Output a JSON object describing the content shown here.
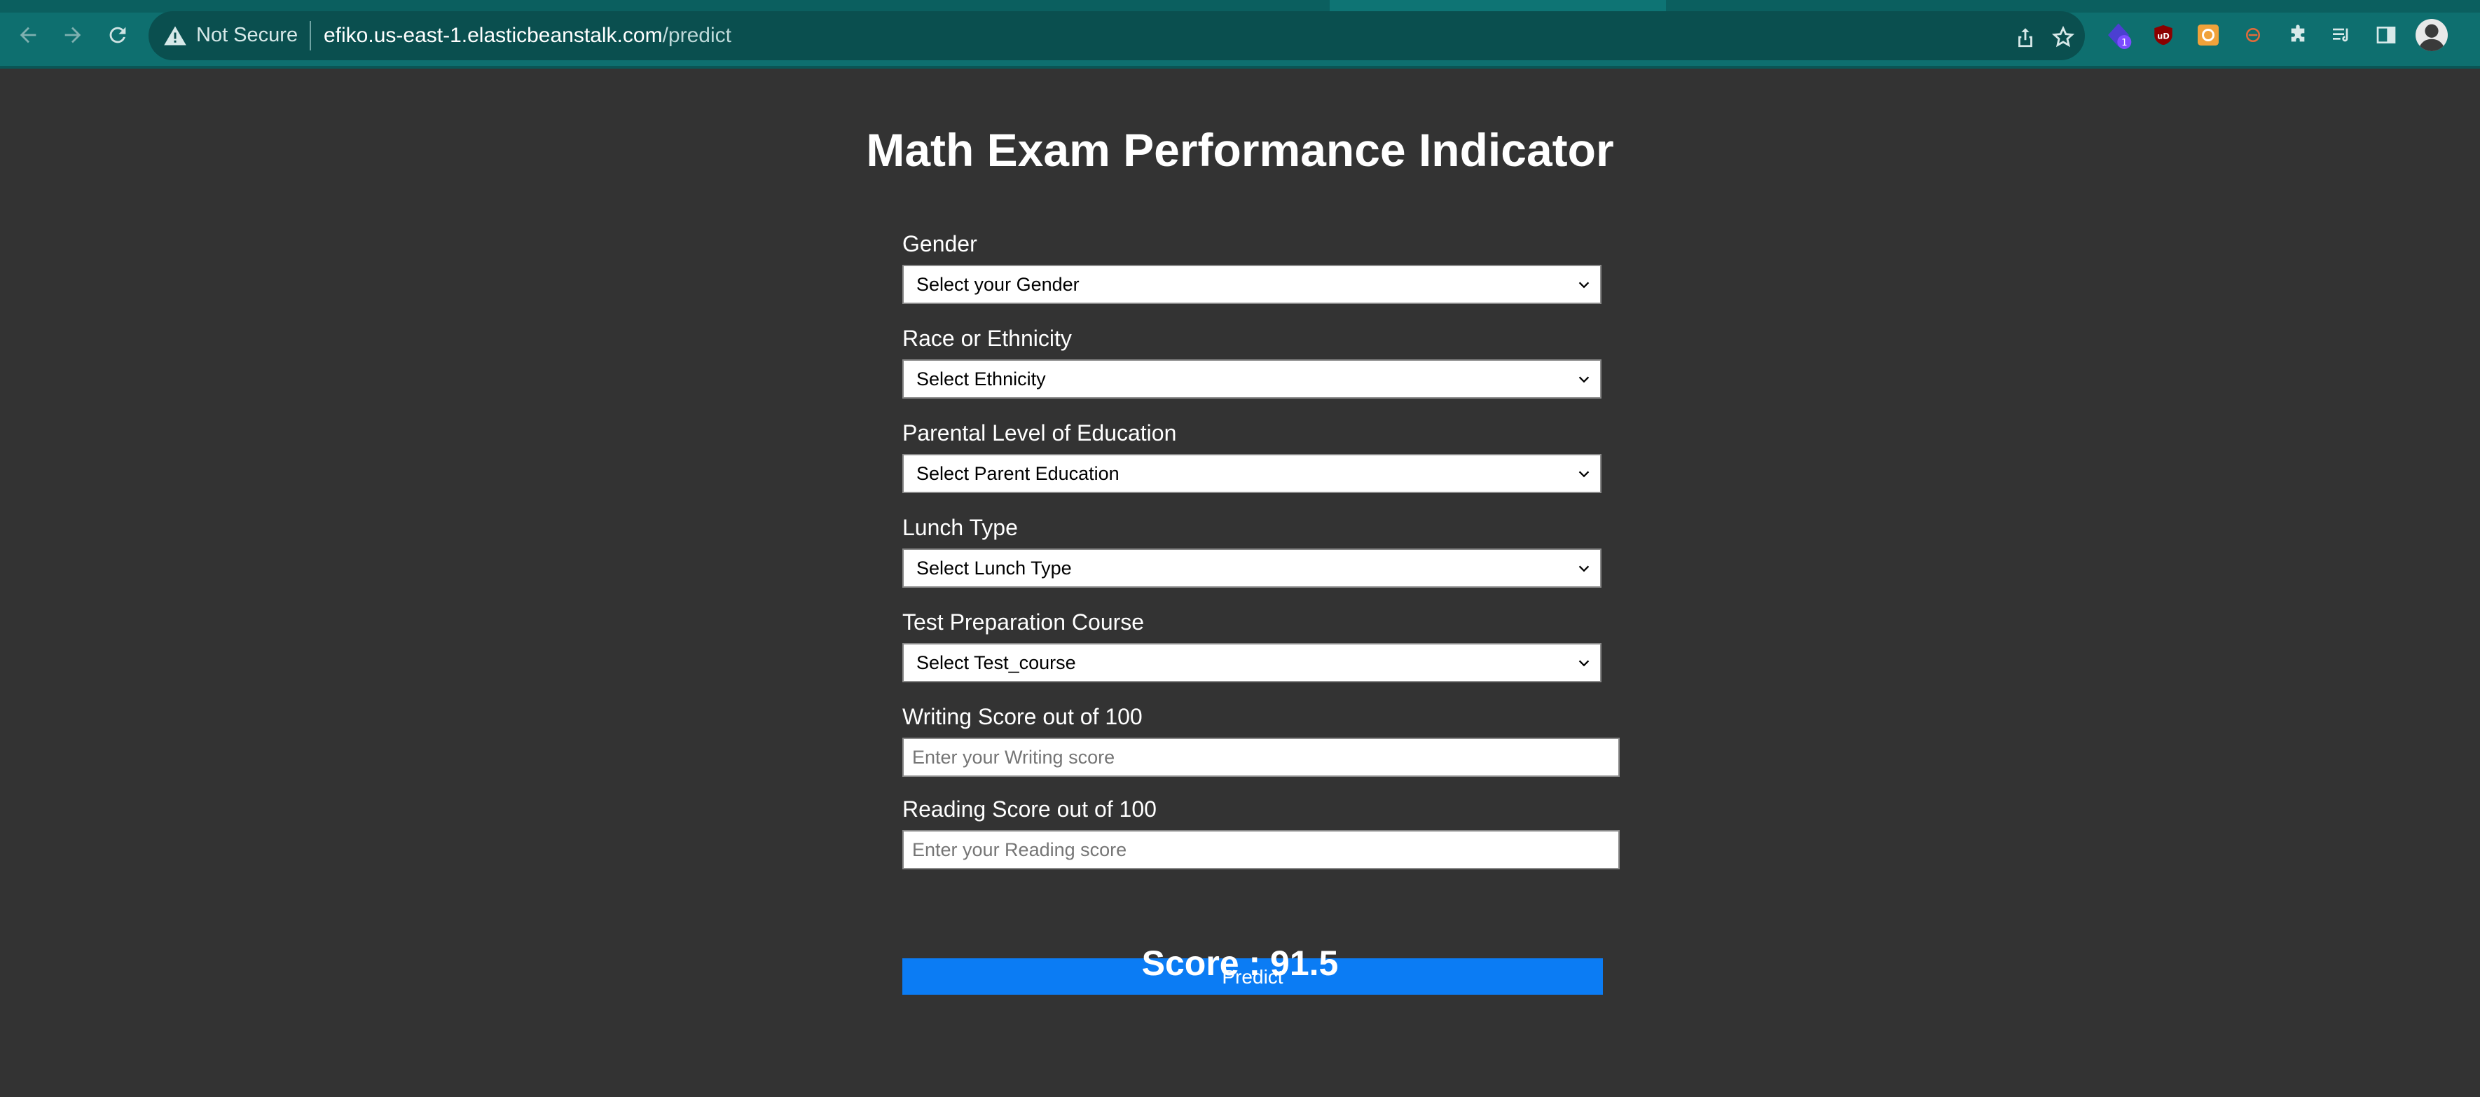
{
  "browser": {
    "security_label": "Not Secure",
    "url_host": "efiko.us-east-1.elasticbeanstalk.com",
    "url_path": "/predict",
    "extension_badge": "1"
  },
  "page": {
    "title": "Math Exam Performance Indicator",
    "fields": [
      {
        "label": "Gender",
        "selected": "Select your Gender"
      },
      {
        "label": "Race or Ethnicity",
        "selected": "Select Ethnicity"
      },
      {
        "label": "Parental Level of Education",
        "selected": "Select Parent Education"
      },
      {
        "label": "Lunch Type",
        "selected": "Select Lunch Type"
      },
      {
        "label": "Test Preparation Course",
        "selected": "Select Test_course"
      }
    ],
    "writing": {
      "label": "Writing Score out of 100",
      "placeholder": "Enter your Writing score",
      "value": ""
    },
    "reading": {
      "label": "Reading Score out of 100",
      "placeholder": "Enter your Reading score",
      "value": ""
    },
    "predict_label": "Predict",
    "score_text": "Score : 91.5"
  },
  "colors": {
    "toolbar": "#0e6f6f",
    "page_bg": "#333333",
    "button": "#0b7cf4"
  }
}
